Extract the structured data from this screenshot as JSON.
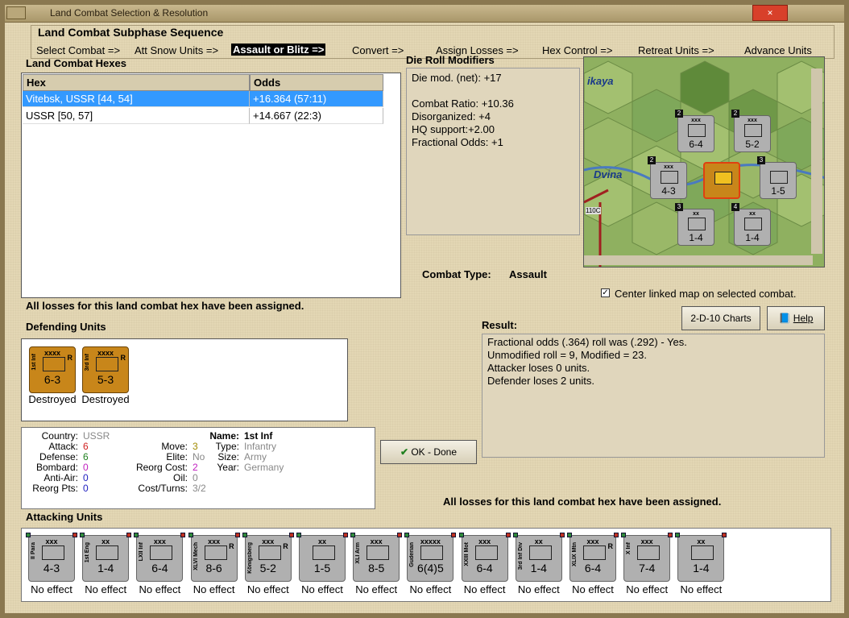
{
  "window": {
    "title": "Land Combat Selection & Resolution"
  },
  "sequence": {
    "title": "Land Combat Subphase Sequence",
    "steps": [
      "Select Combat =>",
      "Att Snow Units =>",
      "Assault or Blitz =>",
      "Convert =>",
      "Assign Losses =>",
      "Hex Control =>",
      "Retreat Units =>",
      "Advance Units"
    ],
    "active_index": 2
  },
  "hexes": {
    "title": "Land Combat Hexes",
    "headers": [
      "Hex",
      "Odds"
    ],
    "rows": [
      {
        "hex": "Vitebsk, USSR [44, 54]",
        "odds": "+16.364 (57:11)"
      },
      {
        "hex": "USSR [50, 57]",
        "odds": "+14.667 (22:3)"
      }
    ]
  },
  "die_roll": {
    "title": "Die Roll Modifiers",
    "lines": [
      "Die mod. (net): +17",
      "",
      "Combat Ratio: +10.36",
      "Disorganized: +4",
      "HQ support:+2.00",
      "Fractional Odds: +1"
    ]
  },
  "map": {
    "labels": [
      "ikaya",
      "Dvina",
      "110C"
    ],
    "counters": [
      {
        "size": "xxx",
        "val": "6-4",
        "name": "LXII Inf",
        "badge": "2"
      },
      {
        "size": "xxx",
        "val": "5-2",
        "name": "Königsberg",
        "badge": "2"
      },
      {
        "size": "xxx",
        "val": "4-3",
        "name": "II Para",
        "badge": "2"
      },
      {
        "size": "xxx",
        "val": "1-5",
        "name": "",
        "badge": "3"
      },
      {
        "size": "xx",
        "val": "1-4",
        "name": "",
        "badge": "3"
      },
      {
        "size": "xx",
        "val": "1-4",
        "name": "3rd Inf Div",
        "badge": "4"
      }
    ],
    "center_link_label": "Center linked map on selected combat."
  },
  "combat_type": {
    "label": "Combat Type:",
    "value": "Assault"
  },
  "losses_msg": "All losses for this land combat hex have been assigned.",
  "buttons": {
    "charts": "2-D-10 Charts",
    "help": "Help",
    "ok": "OK - Done"
  },
  "defending": {
    "title": "Defending Units",
    "units": [
      {
        "size": "xxxx",
        "val": "6-3",
        "name": "1st Inf",
        "r": "R",
        "status": "Destroyed"
      },
      {
        "size": "xxxx",
        "val": "5-3",
        "name": "3rd Inf",
        "r": "R",
        "status": "Destroyed"
      }
    ]
  },
  "result": {
    "title": "Result:",
    "lines": [
      "Fractional odds (.364) roll was (.292)  - Yes.",
      "Unmodified roll = 9, Modified = 23.",
      "Attacker loses 0 units.",
      "Defender loses 2 units."
    ]
  },
  "unit_info": {
    "name_label": "Name:",
    "name": "1st Inf",
    "country_label": "Country:",
    "country": "USSR",
    "attack_label": "Attack:",
    "attack": "6",
    "defense_label": "Defense:",
    "defense": "6",
    "bombard_label": "Bombard:",
    "bombard": "0",
    "antiair_label": "Anti-Air:",
    "antiair": "0",
    "reorgpts_label": "Reorg Pts:",
    "reorgpts": "0",
    "move_label": "Move:",
    "move": "3",
    "elite_label": "Elite:",
    "elite": "No",
    "reorgcost_label": "Reorg Cost:",
    "reorgcost": "2",
    "oil_label": "Oil:",
    "oil": "0",
    "costturns_label": "Cost/Turns:",
    "costturns": "3/2",
    "type_label": "Type:",
    "type": "Infantry",
    "size_label": "Size:",
    "size": "Army",
    "year_label": "Year:",
    "year": "Germany"
  },
  "attacking": {
    "title": "Attacking Units",
    "units": [
      {
        "size": "xxx",
        "val": "4-3",
        "name": "II Para",
        "status": "No effect"
      },
      {
        "size": "xx",
        "val": "1-4",
        "name": "1st Eng",
        "status": "No effect"
      },
      {
        "size": "xxx",
        "val": "6-4",
        "name": "LXII Inf",
        "status": "No effect"
      },
      {
        "size": "xxx",
        "val": "8-6",
        "name": "XLVI Mech",
        "status": "No effect",
        "r": "R"
      },
      {
        "size": "xxx",
        "val": "5-2",
        "name": "Königsberg",
        "status": "No effect",
        "r": "R"
      },
      {
        "size": "xx",
        "val": "1-5",
        "name": "",
        "status": "No effect"
      },
      {
        "size": "xxx",
        "val": "8-5",
        "name": "XLI Arm",
        "status": "No effect"
      },
      {
        "size": "xxxxx",
        "val": "6(4)5",
        "name": "Guderian",
        "status": "No effect"
      },
      {
        "size": "xxx",
        "val": "6-4",
        "name": "XXIII Mot",
        "status": "No effect"
      },
      {
        "size": "xx",
        "val": "1-4",
        "name": "3rd Inf Div",
        "status": "No effect"
      },
      {
        "size": "xxx",
        "val": "6-4",
        "name": "XLIX Mtn",
        "status": "No effect",
        "r": "R"
      },
      {
        "size": "xxx",
        "val": "7-4",
        "name": "X Inf",
        "status": "No effect"
      },
      {
        "size": "xx",
        "val": "1-4",
        "name": "",
        "status": "No effect"
      }
    ]
  },
  "colors": {
    "selected_row": "#3399ff",
    "orange_counter": "#c8861a",
    "gray_counter": "#b0b0b0"
  }
}
